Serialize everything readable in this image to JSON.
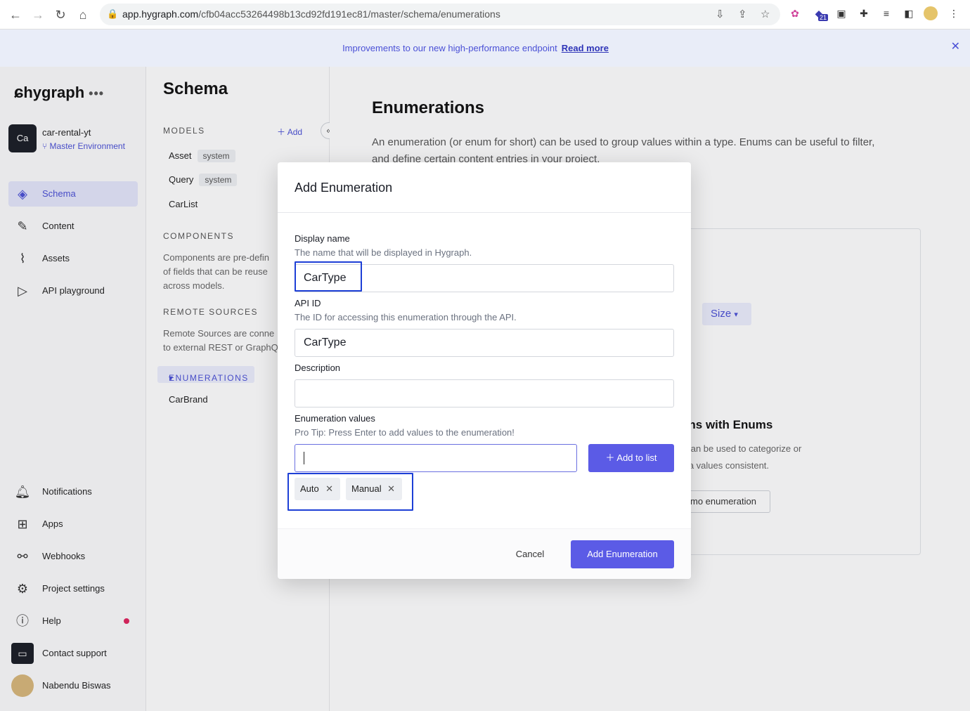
{
  "browser": {
    "url_host": "app.hygraph.com",
    "url_path": "/cfb04acc53264498b13cd92fd191ec81/master/schema/enumerations",
    "ext_badge": "21"
  },
  "banner": {
    "text": "Improvements to our new high-performance endpoint",
    "link": "Read more"
  },
  "sidebar": {
    "logo": "hygraph",
    "logo_dots": "•••",
    "project_badge": "Ca",
    "project_name": "car-rental-yt",
    "environment": "Master Environment",
    "nav": [
      {
        "label": "Schema",
        "icon": "layers-icon"
      },
      {
        "label": "Content",
        "icon": "edit-icon"
      },
      {
        "label": "Assets",
        "icon": "paperclip-icon"
      },
      {
        "label": "API playground",
        "icon": "play-icon"
      }
    ],
    "bottom": [
      {
        "label": "Notifications",
        "icon": "bell-icon"
      },
      {
        "label": "Apps",
        "icon": "apps-grid-icon"
      },
      {
        "label": "Webhooks",
        "icon": "webhook-icon"
      },
      {
        "label": "Project settings",
        "icon": "gear-icon"
      },
      {
        "label": "Help",
        "icon": "help-icon"
      },
      {
        "label": "Contact support",
        "icon": "chat-icon"
      },
      {
        "label": "Nabendu Biswas",
        "icon": "avatar"
      }
    ]
  },
  "schema": {
    "title": "Schema",
    "models_heading": "MODELS",
    "add_label": "Add",
    "models": [
      {
        "name": "Asset",
        "tag": "system"
      },
      {
        "name": "Query",
        "tag": "system"
      },
      {
        "name": "CarList",
        "tag": ""
      }
    ],
    "components_heading": "COMPONENTS",
    "components_desc": [
      "Components are pre-defin",
      "of fields that can be reuse",
      "across models."
    ],
    "remote_heading": "REMOTE SOURCES",
    "remote_desc": [
      "Remote Sources are conne",
      "to external REST or GraphQ"
    ],
    "enumerations_heading": "ENUMERATIONS",
    "enumerations": [
      "CarBrand"
    ]
  },
  "main": {
    "title": "Enumerations",
    "desc_line1": "An enumeration (or enum for short) can be used to group values within a type. Enums can be useful to filter,",
    "desc_line2": "and define certain content entries in your project.",
    "size_label": "Size",
    "card_heading": "ons with Enums",
    "card_p1": "t can be used to categorize or",
    "card_p2": "ata values consistent.",
    "card_button": "mo enumeration"
  },
  "modal": {
    "title": "Add Enumeration",
    "display_name_label": "Display name",
    "display_name_help": "The name that will be displayed in Hygraph.",
    "display_name_value": "CarType",
    "api_id_label": "API ID",
    "api_id_help": "The ID for accessing this enumeration through the API.",
    "api_id_value": "CarType",
    "description_label": "Description",
    "description_value": "",
    "values_label": "Enumeration values",
    "values_help": "Pro Tip: Press Enter to add values to the enumeration!",
    "add_to_list_label": "Add to list",
    "chips": [
      "Auto",
      "Manual"
    ],
    "cancel_label": "Cancel",
    "submit_label": "Add Enumeration"
  }
}
